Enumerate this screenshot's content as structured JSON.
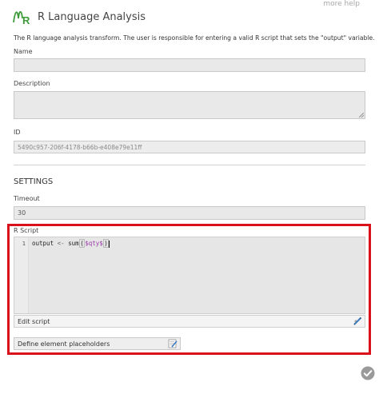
{
  "header": {
    "more_help": "more help",
    "title": "R Language Analysis",
    "logo_icon": "r-language-logo-icon"
  },
  "description": "The R language analysis transform. The user is responsible for entering a valid R script that sets the \"output\" variable.",
  "fields": {
    "name": {
      "label": "Name",
      "value": ""
    },
    "description": {
      "label": "Description",
      "value": ""
    },
    "id": {
      "label": "ID",
      "value": "5490c957-206f-4178-b66b-e408e79e11ff"
    }
  },
  "settings": {
    "title": "SETTINGS",
    "timeout": {
      "label": "Timeout",
      "value": "30"
    },
    "r_script": {
      "label": "R Script",
      "line_number": "1",
      "code": {
        "var": "output",
        "op": "<-",
        "fn": "sum",
        "open": "(",
        "arg": "$qty$",
        "close": ")"
      },
      "edit_label": "Edit script",
      "edit_icon": "edit-pencil-icon"
    },
    "placeholders_button": "Define element placeholders",
    "placeholders_icon": "edit-list-icon"
  },
  "colors": {
    "highlight_border": "#d9111b",
    "logo_green": "#3e9b3a",
    "ok_grey": "#9a9a9a"
  },
  "ok_icon": "checkmark-circle-icon"
}
